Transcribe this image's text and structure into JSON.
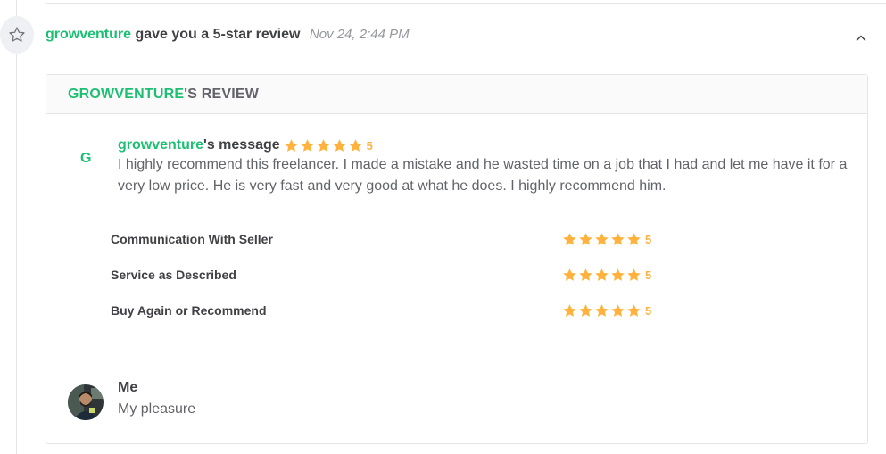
{
  "event": {
    "username": "growventure",
    "action": "gave you a 5-star review",
    "timestamp": "Nov 24, 2:44 PM",
    "icon": "star-outline-icon"
  },
  "review": {
    "header_user": "GROWVENTURE",
    "header_suffix": "'S REVIEW",
    "buyer_initial": "G",
    "buyer_name": "growventure",
    "message_suffix": "'s message",
    "overall_rating": "5",
    "text": "I highly recommend this freelancer. I made a mistake and he wasted time on a job that I had and let me have it for a very low price. He is very fast and very good at what he does. I highly recommend him.",
    "breakdown": [
      {
        "label": "Communication With Seller",
        "rating": "5"
      },
      {
        "label": "Service as Described",
        "rating": "5"
      },
      {
        "label": "Buy Again or Recommend",
        "rating": "5"
      }
    ]
  },
  "reply": {
    "name": "Me",
    "text": "My pleasure"
  },
  "colors": {
    "accent": "#1dbf73",
    "star": "#ffb33e",
    "text_dark": "#404145",
    "text": "#62646a",
    "border": "#e4e5e7"
  }
}
